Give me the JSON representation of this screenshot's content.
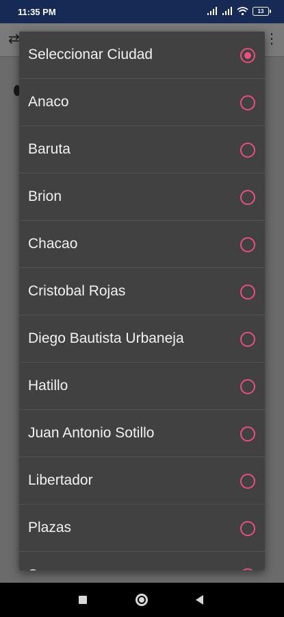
{
  "status_bar": {
    "time": "11:35 PM",
    "battery": "13"
  },
  "dialog": {
    "options": [
      {
        "label": "Seleccionar Ciudad",
        "selected": true
      },
      {
        "label": "Anaco",
        "selected": false
      },
      {
        "label": "Baruta",
        "selected": false
      },
      {
        "label": "Brion",
        "selected": false
      },
      {
        "label": "Chacao",
        "selected": false
      },
      {
        "label": "Cristobal Rojas",
        "selected": false
      },
      {
        "label": "Diego Bautista Urbaneja",
        "selected": false
      },
      {
        "label": "Hatillo",
        "selected": false
      },
      {
        "label": "Juan Antonio Sotillo",
        "selected": false
      },
      {
        "label": "Libertador",
        "selected": false
      },
      {
        "label": "Plazas",
        "selected": false
      },
      {
        "label": "Sucre",
        "selected": false
      }
    ]
  },
  "colors": {
    "accent": "#e8507f",
    "dialog_bg": "#414141",
    "status_bar_bg": "#172a55"
  }
}
